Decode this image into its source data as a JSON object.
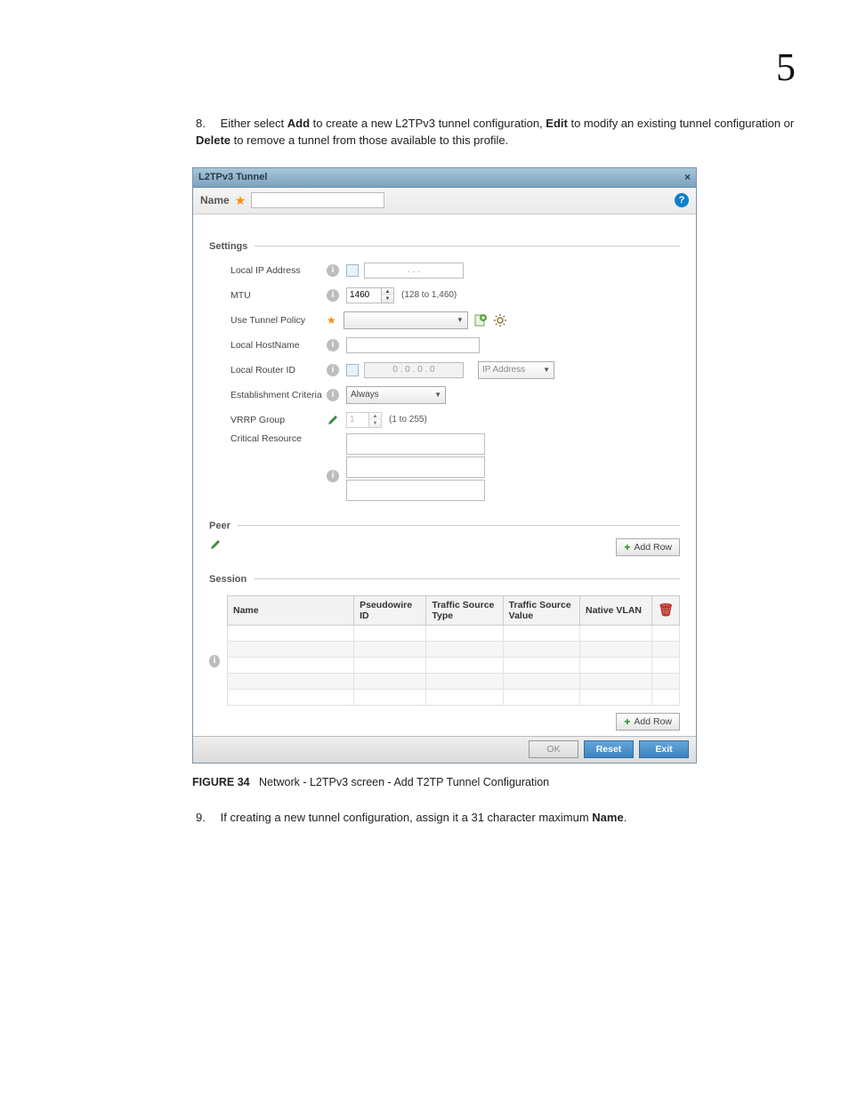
{
  "page": {
    "number": "5"
  },
  "step8": {
    "pre": "Either select ",
    "b1": "Add",
    "mid1": " to create a new L2TPv3 tunnel configuration, ",
    "b2": "Edit",
    "mid2": " to modify an existing tunnel configuration or ",
    "b3": "Delete",
    "post": " to remove a tunnel from those available to this profile."
  },
  "dialog": {
    "title": "L2TPv3 Tunnel",
    "name_label": "Name",
    "help": "?",
    "close": "×",
    "sections": {
      "settings": "Settings",
      "peer": "Peer",
      "session": "Session"
    },
    "fields": {
      "local_ip": {
        "label": "Local IP Address",
        "value": ".   .   ."
      },
      "mtu": {
        "label": "MTU",
        "value": "1460",
        "hint": "(128 to 1,460)"
      },
      "use_policy": {
        "label": "Use Tunnel Policy"
      },
      "local_hostname": {
        "label": "Local HostName"
      },
      "local_router_id": {
        "label": "Local Router ID",
        "value": "0  .  0  .  0  .  0",
        "select": "IP Address"
      },
      "est_criteria": {
        "label": "Establishment Criteria",
        "value": "Always"
      },
      "vrrp": {
        "label": "VRRP Group",
        "value": "1",
        "hint": "(1 to 255)"
      },
      "critical": {
        "label": "Critical Resource"
      }
    },
    "add_row": "Add Row",
    "session_cols": {
      "name": "Name",
      "pwid": "Pseudowire ID",
      "src_type": "Traffic Source Type",
      "src_val": "Traffic Source Value",
      "native_vlan": "Native VLAN"
    },
    "buttons": {
      "ok": "OK",
      "reset": "Reset",
      "exit": "Exit"
    }
  },
  "figure": {
    "label": "FIGURE 34",
    "caption": "Network - L2TPv3 screen - Add T2TP Tunnel Configuration"
  },
  "step9": {
    "pre": "If creating a new tunnel configuration, assign it a 31 character maximum ",
    "b1": "Name",
    "post": "."
  }
}
